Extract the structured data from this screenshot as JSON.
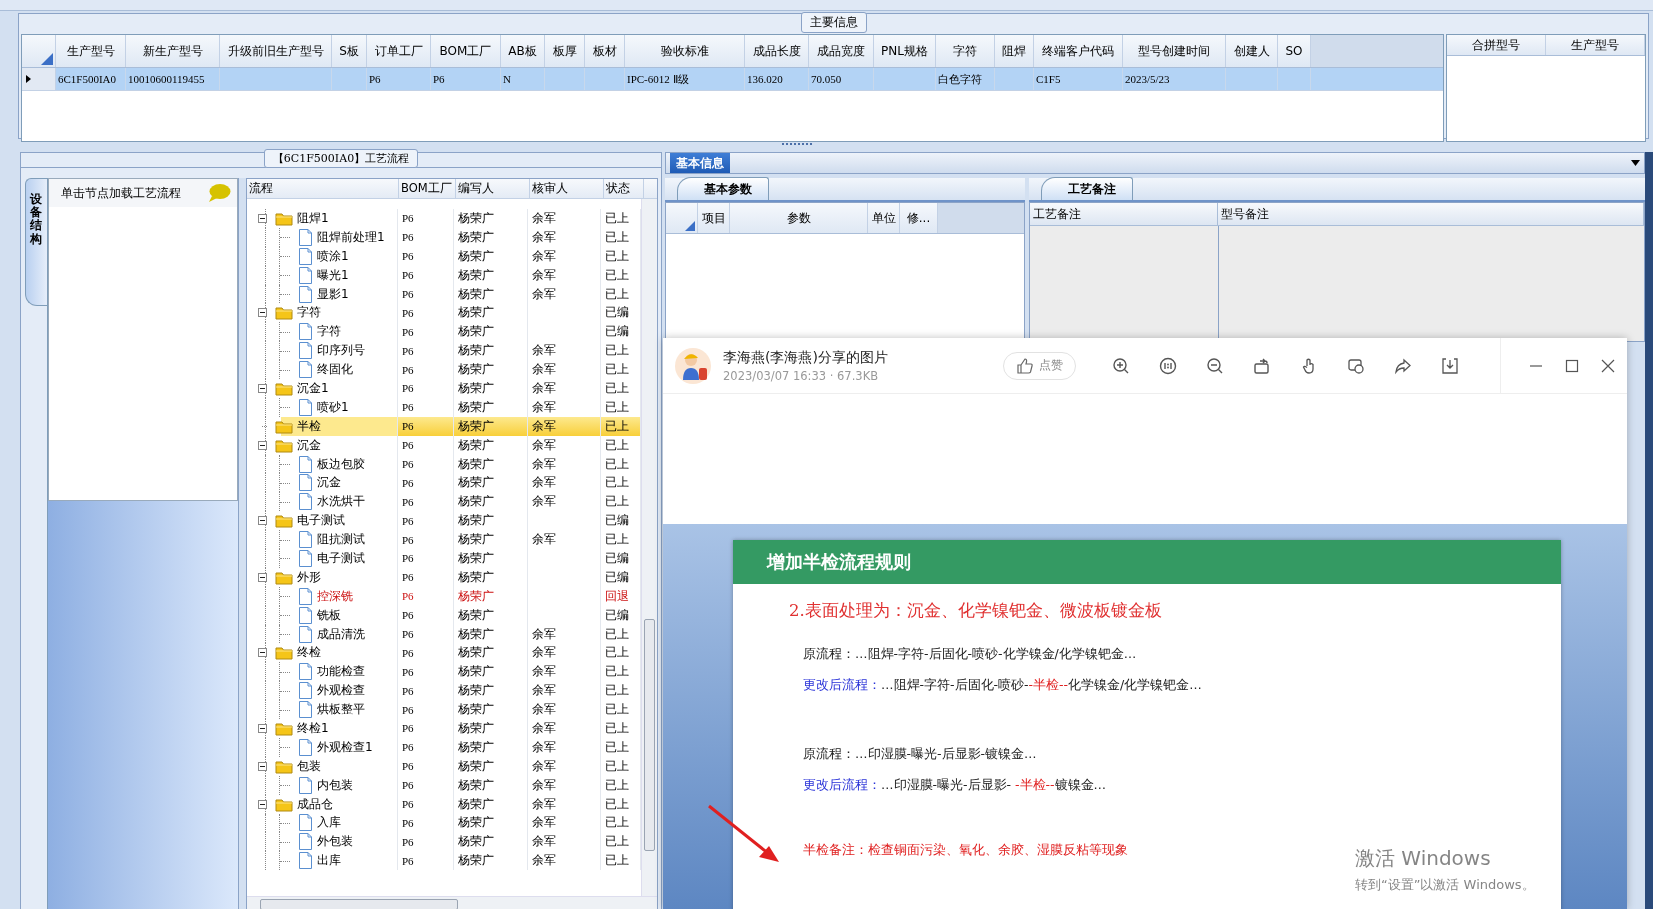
{
  "top_group": {
    "legend": "主要信息"
  },
  "main_table": {
    "columns": [
      "生产型号",
      "新生产型号",
      "升级前旧生产型号",
      "S板",
      "订单工厂",
      "BOM工厂",
      "AB板",
      "板厚",
      "板材",
      "验收标准",
      "成品长度",
      "成品宽度",
      "PNL规格",
      "字符",
      "阻焊",
      "终端客户代码",
      "型号创建时间",
      "创建人",
      "SO"
    ],
    "rows": [
      {
        "selected": true,
        "cells": [
          "6C1F500IA0",
          "10010600119455",
          "",
          "",
          "P6",
          "P6",
          "N",
          "",
          "",
          "IPC-6012 Ⅱ级",
          "136.020",
          "70.050",
          "",
          "白色字符",
          "",
          "C1F5",
          "2023/5/23",
          "",
          ""
        ]
      }
    ]
  },
  "merge_table": {
    "columns": [
      "合拼型号",
      "生产型号"
    ]
  },
  "flow_panel": {
    "title": "【6C1F500IA0】工艺流程",
    "side_tab": "设备结构",
    "hint": "单击节点加载工艺流程",
    "columns": [
      "流程",
      "BOM工厂",
      "编写人",
      "核审人",
      "状态"
    ],
    "rows": [
      {
        "kind": "folder",
        "label": "阻焊1",
        "bom": "P6",
        "author": "杨荣广",
        "reviewer": "余军",
        "status": "已上",
        "expanded": true,
        "selected": false,
        "children": [
          {
            "kind": "file",
            "label": "阻焊前处理1",
            "bom": "P6",
            "author": "杨荣广",
            "reviewer": "余军",
            "status": "已上",
            "selected": false
          },
          {
            "kind": "file",
            "label": "喷涂1",
            "bom": "P6",
            "author": "杨荣广",
            "reviewer": "余军",
            "status": "已上",
            "selected": false
          },
          {
            "kind": "file",
            "label": "曝光1",
            "bom": "P6",
            "author": "杨荣广",
            "reviewer": "余军",
            "status": "已上",
            "selected": false
          },
          {
            "kind": "file",
            "label": "显影1",
            "bom": "P6",
            "author": "杨荣广",
            "reviewer": "余军",
            "status": "已上",
            "selected": false
          }
        ]
      },
      {
        "kind": "folder",
        "label": "字符",
        "bom": "P6",
        "author": "杨荣广",
        "status": "已编",
        "expanded": true,
        "selected": false,
        "children": [
          {
            "kind": "file",
            "label": "字符",
            "bom": "P6",
            "author": "杨荣广",
            "status": "已编",
            "selected": false
          },
          {
            "kind": "file",
            "label": "印序列号",
            "bom": "P6",
            "author": "杨荣广",
            "reviewer": "余军",
            "status": "已上",
            "selected": false
          },
          {
            "kind": "file",
            "label": "终固化",
            "bom": "P6",
            "author": "杨荣广",
            "reviewer": "余军",
            "status": "已上",
            "selected": false
          }
        ]
      },
      {
        "kind": "folder",
        "label": "沉金1",
        "bom": "P6",
        "author": "杨荣广",
        "reviewer": "余军",
        "status": "已上",
        "expanded": true,
        "selected": false,
        "children": [
          {
            "kind": "file",
            "label": "喷砂1",
            "bom": "P6",
            "author": "杨荣广",
            "reviewer": "余军",
            "status": "已上",
            "selected": false
          }
        ]
      },
      {
        "kind": "folder",
        "label": "半检",
        "bom": "P6",
        "author": "杨荣广",
        "reviewer": "余军",
        "status": "已上",
        "selected": true
      },
      {
        "kind": "folder",
        "label": "沉金",
        "bom": "P6",
        "author": "杨荣广",
        "reviewer": "余军",
        "status": "已上",
        "expanded": true,
        "selected": false,
        "children": [
          {
            "kind": "file",
            "label": "板边包胶",
            "bom": "P6",
            "author": "杨荣广",
            "reviewer": "余军",
            "status": "已上",
            "selected": false
          },
          {
            "kind": "file",
            "label": "沉金",
            "bom": "P6",
            "author": "杨荣广",
            "reviewer": "余军",
            "status": "已上",
            "selected": false
          },
          {
            "kind": "file",
            "label": "水洗烘干",
            "bom": "P6",
            "author": "杨荣广",
            "reviewer": "余军",
            "status": "已上",
            "selected": false
          }
        ]
      },
      {
        "kind": "folder",
        "label": "电子测试",
        "bom": "P6",
        "author": "杨荣广",
        "status": "已编",
        "expanded": true,
        "selected": false,
        "children": [
          {
            "kind": "file",
            "label": "阻抗测试",
            "bom": "P6",
            "author": "杨荣广",
            "reviewer": "余军",
            "status": "已上",
            "selected": false
          },
          {
            "kind": "file",
            "label": "电子测试",
            "bom": "P6",
            "author": "杨荣广",
            "status": "已编",
            "selected": false
          }
        ]
      },
      {
        "kind": "folder",
        "label": "外形",
        "bom": "P6",
        "author": "杨荣广",
        "status": "已编",
        "expanded": true,
        "selected": false,
        "children": [
          {
            "kind": "file",
            "label": "控深铣",
            "bom": "P6",
            "author": "杨荣广",
            "status": "回退",
            "color": "#cc1111",
            "selected": false
          },
          {
            "kind": "file",
            "label": "铣板",
            "bom": "P6",
            "author": "杨荣广",
            "status": "已编",
            "selected": false
          },
          {
            "kind": "file",
            "label": "成品清洗",
            "bom": "P6",
            "author": "杨荣广",
            "reviewer": "余军",
            "status": "已上",
            "selected": false
          }
        ]
      },
      {
        "kind": "folder",
        "label": "终检",
        "bom": "P6",
        "author": "杨荣广",
        "reviewer": "余军",
        "status": "已上",
        "expanded": true,
        "selected": false,
        "children": [
          {
            "kind": "file",
            "label": "功能检查",
            "bom": "P6",
            "author": "杨荣广",
            "reviewer": "余军",
            "status": "已上",
            "selected": false
          },
          {
            "kind": "file",
            "label": "外观检查",
            "bom": "P6",
            "author": "杨荣广",
            "reviewer": "余军",
            "status": "已上",
            "selected": false
          },
          {
            "kind": "file",
            "label": "烘板整平",
            "bom": "P6",
            "author": "杨荣广",
            "reviewer": "余军",
            "status": "已上",
            "selected": false
          }
        ]
      },
      {
        "kind": "folder",
        "label": "终检1",
        "bom": "P6",
        "author": "杨荣广",
        "reviewer": "余军",
        "status": "已上",
        "expanded": true,
        "selected": false,
        "children": [
          {
            "kind": "file",
            "label": "外观检查1",
            "bom": "P6",
            "author": "杨荣广",
            "reviewer": "余军",
            "status": "已上",
            "selected": false
          }
        ]
      },
      {
        "kind": "folder",
        "label": "包装",
        "bom": "P6",
        "author": "杨荣广",
        "reviewer": "余军",
        "status": "已上",
        "expanded": true,
        "selected": false,
        "children": [
          {
            "kind": "file",
            "label": "内包装",
            "bom": "P6",
            "author": "杨荣广",
            "reviewer": "余军",
            "status": "已上",
            "selected": false
          }
        ]
      },
      {
        "kind": "folder",
        "label": "成品仓",
        "bom": "P6",
        "author": "杨荣广",
        "reviewer": "余军",
        "status": "已上",
        "expanded": true,
        "selected": false,
        "children": [
          {
            "kind": "file",
            "label": "入库",
            "bom": "P6",
            "author": "杨荣广",
            "reviewer": "余军",
            "status": "已上",
            "selected": false
          },
          {
            "kind": "file",
            "label": "外包装",
            "bom": "P6",
            "author": "杨荣广",
            "reviewer": "余军",
            "status": "已上",
            "selected": false
          },
          {
            "kind": "file",
            "label": "出库",
            "bom": "P6",
            "author": "杨荣广",
            "reviewer": "余军",
            "status": "已上",
            "selected": false
          }
        ]
      }
    ]
  },
  "info_panel": {
    "tab": "基本信息",
    "params": {
      "tab": "基本参数",
      "columns": [
        "项目",
        "参数",
        "单位",
        "修..."
      ]
    },
    "notes": {
      "tab": "工艺备注",
      "columns": [
        "工艺备注",
        "型号备注"
      ]
    }
  },
  "viewer": {
    "title": "李海燕(李海燕)分享的图片",
    "meta": "2023/03/07 16:33 · 67.3KB",
    "like": "点赞",
    "slide": {
      "heading": "增加半检流程规则",
      "subheading": "2.表面处理为：沉金、化学镍钯金、微波板镀金板",
      "blocks": [
        {
          "lines": [
            {
              "parts": [
                {
                  "kind": "plain",
                  "text": "原流程：…阻焊-字符-后固化-喷砂-化学镍金/化学镍钯金…"
                }
              ]
            },
            {
              "parts": [
                {
                  "kind": "label",
                  "text": "更改后流程："
                },
                {
                  "kind": "plain",
                  "text": "…阻焊-字符-后固化-喷砂-"
                },
                {
                  "kind": "mark",
                  "text": "-半检--"
                },
                {
                  "kind": "plain",
                  "text": "化学镍金/化学镍钯金…"
                }
              ]
            }
          ]
        },
        {
          "lines": [
            {
              "parts": [
                {
                  "kind": "plain",
                  "text": "原流程：…印湿膜-曝光-后显影-镀镍金…"
                }
              ]
            },
            {
              "parts": [
                {
                  "kind": "label",
                  "text": "更改后流程："
                },
                {
                  "kind": "plain",
                  "text": "…印湿膜-曝光-后显影- "
                },
                {
                  "kind": "mark",
                  "text": "-半检--"
                },
                {
                  "kind": "plain",
                  "text": "镀镍金…"
                }
              ]
            }
          ]
        }
      ],
      "note": "半检备注：检查铜面污染、氧化、余胶、湿膜反粘等现象"
    }
  },
  "watermark": {
    "title": "激活 Windows",
    "hint": "转到“设置”以激活 Windows。"
  }
}
